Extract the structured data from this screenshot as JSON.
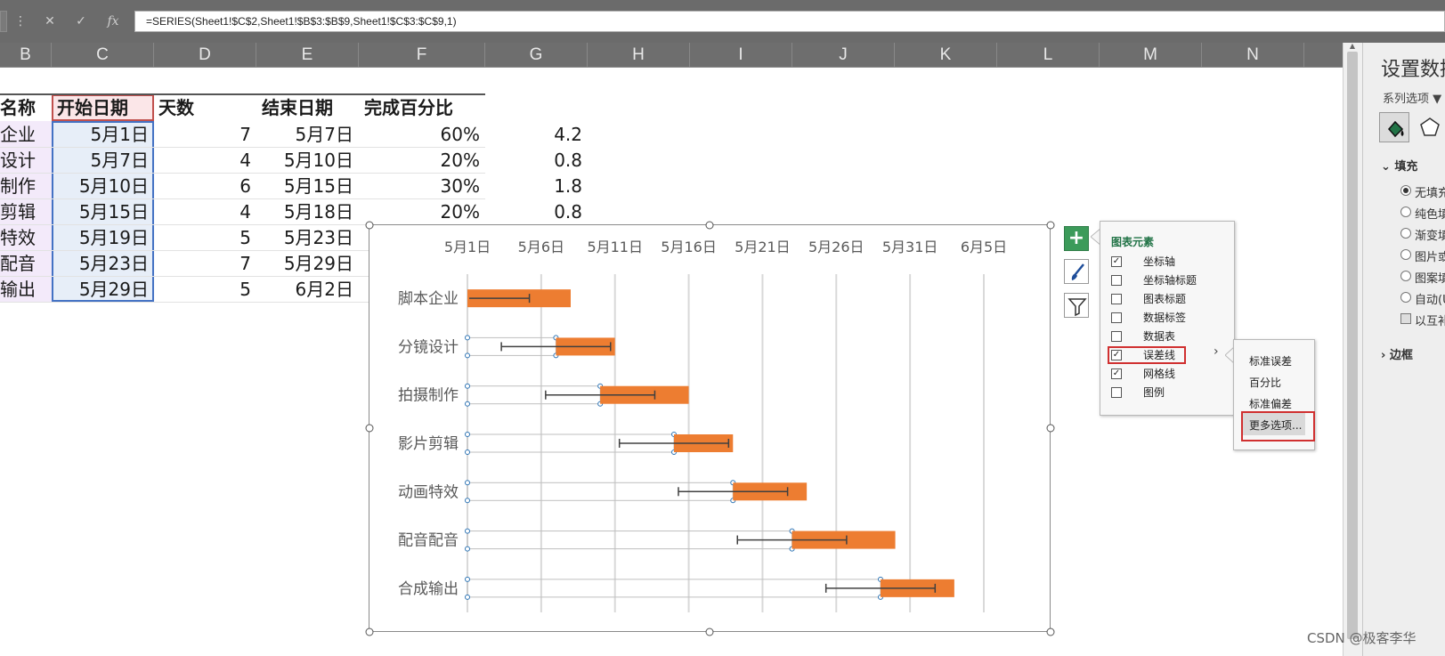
{
  "formula_bar": {
    "more_icon": "⋮",
    "cancel_icon": "✕",
    "enter_icon": "✓",
    "fx_icon": "fx",
    "formula": "=SERIES(Sheet1!$C$2,Sheet1!$B$3:$B$9,Sheet1!$C$3:$C$9,1)"
  },
  "columns": [
    "B",
    "C",
    "D",
    "E",
    "F",
    "G",
    "H",
    "I",
    "J",
    "K",
    "L",
    "M",
    "N"
  ],
  "table": {
    "headers": [
      "名称",
      "开始日期",
      "天数",
      "结束日期",
      "完成百分比"
    ],
    "rows": [
      {
        "name": "企业",
        "start": "5月1日",
        "days": "7",
        "end": "5月7日",
        "pct": "60%",
        "g": "4.2"
      },
      {
        "name": "设计",
        "start": "5月7日",
        "days": "4",
        "end": "5月10日",
        "pct": "20%",
        "g": "0.8"
      },
      {
        "name": "制作",
        "start": "5月10日",
        "days": "6",
        "end": "5月15日",
        "pct": "30%",
        "g": "1.8"
      },
      {
        "name": "剪辑",
        "start": "5月15日",
        "days": "4",
        "end": "5月18日",
        "pct": "20%",
        "g": "0.8"
      },
      {
        "name": "特效",
        "start": "5月19日",
        "days": "5",
        "end": "5月23日",
        "pct": "",
        "g": ""
      },
      {
        "name": "配音",
        "start": "5月23日",
        "days": "7",
        "end": "5月29日",
        "pct": "",
        "g": ""
      },
      {
        "name": "输出",
        "start": "5月29日",
        "days": "5",
        "end": "6月2日",
        "pct": "",
        "g": ""
      }
    ]
  },
  "chart_data": {
    "type": "bar",
    "orientation": "horizontal-stacked",
    "x_tick_labels": [
      "5月1日",
      "5月6日",
      "5月11日",
      "5月16日",
      "5月21日",
      "5月26日",
      "5月31日",
      "6月5日"
    ],
    "xlim": [
      0,
      35
    ],
    "categories": [
      "脚本企业",
      "分镜设计",
      "拍摄制作",
      "影片剪辑",
      "动画特效",
      "配音配音",
      "合成输出"
    ],
    "series": [
      {
        "role": "start_offset",
        "values": [
          0,
          6,
          9,
          14,
          18,
          22,
          28
        ],
        "fill": "none"
      },
      {
        "role": "duration",
        "values": [
          7,
          4,
          6,
          4,
          5,
          7,
          5
        ],
        "color": "#ed7d31"
      }
    ],
    "error_bar_minus": [
      4.2,
      3.7,
      3.7,
      3.7,
      3.7,
      3.7,
      3.7
    ],
    "error_bar_plus": [
      0,
      3.7,
      3.7,
      3.7,
      3.7,
      3.7,
      3.7
    ],
    "grid": "vertical",
    "selected_series": "start_offset"
  },
  "chart_tools": {
    "add_icon": "+",
    "style_icon": "brush",
    "filter_icon": "filter"
  },
  "chart_elements": {
    "title": "图表元素",
    "items": [
      {
        "label": "坐标轴",
        "checked": true
      },
      {
        "label": "坐标轴标题",
        "checked": false
      },
      {
        "label": "图表标题",
        "checked": false
      },
      {
        "label": "数据标签",
        "checked": false
      },
      {
        "label": "数据表",
        "checked": false
      },
      {
        "label": "误差线",
        "checked": true
      },
      {
        "label": "网格线",
        "checked": true
      },
      {
        "label": "图例",
        "checked": false
      }
    ],
    "arrow": "›"
  },
  "error_submenu": {
    "items": [
      "标准误差",
      "百分比",
      "标准偏差",
      "更多选项..."
    ]
  },
  "format_pane": {
    "title": "设置数据",
    "subtitle": "系列选项 ▼",
    "section_fill": "填充",
    "options": [
      "无填充",
      "纯色填",
      "渐变填",
      "图片或",
      "图案填",
      "自动(U",
      "以互补"
    ],
    "section_border": "边框"
  },
  "watermark": "CSDN @极客李华"
}
